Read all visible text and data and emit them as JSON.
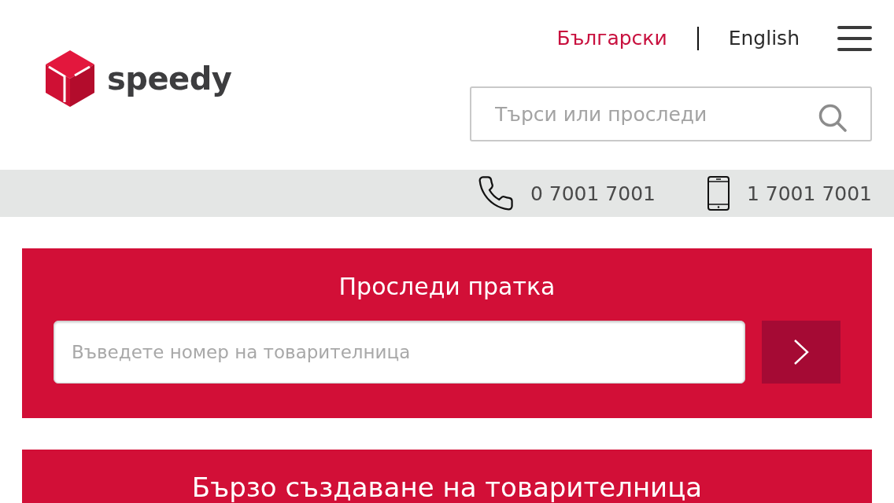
{
  "header": {
    "logo": {
      "wordmark": "speedy"
    },
    "languages": [
      {
        "label": "Български",
        "selected": true
      },
      {
        "label": "English",
        "selected": false
      }
    ],
    "search": {
      "placeholder": "Търси или проследи"
    }
  },
  "contact_bar": {
    "phones": [
      {
        "kind": "landline",
        "number": "0 7001 7001"
      },
      {
        "kind": "mobile",
        "number": "1 7001 7001"
      }
    ]
  },
  "track_panel": {
    "title": "Проследи пратка",
    "input": {
      "placeholder": "Въведете номер на товарителница"
    }
  },
  "create_panel": {
    "title": "Бързо създаване на товарителница"
  }
}
